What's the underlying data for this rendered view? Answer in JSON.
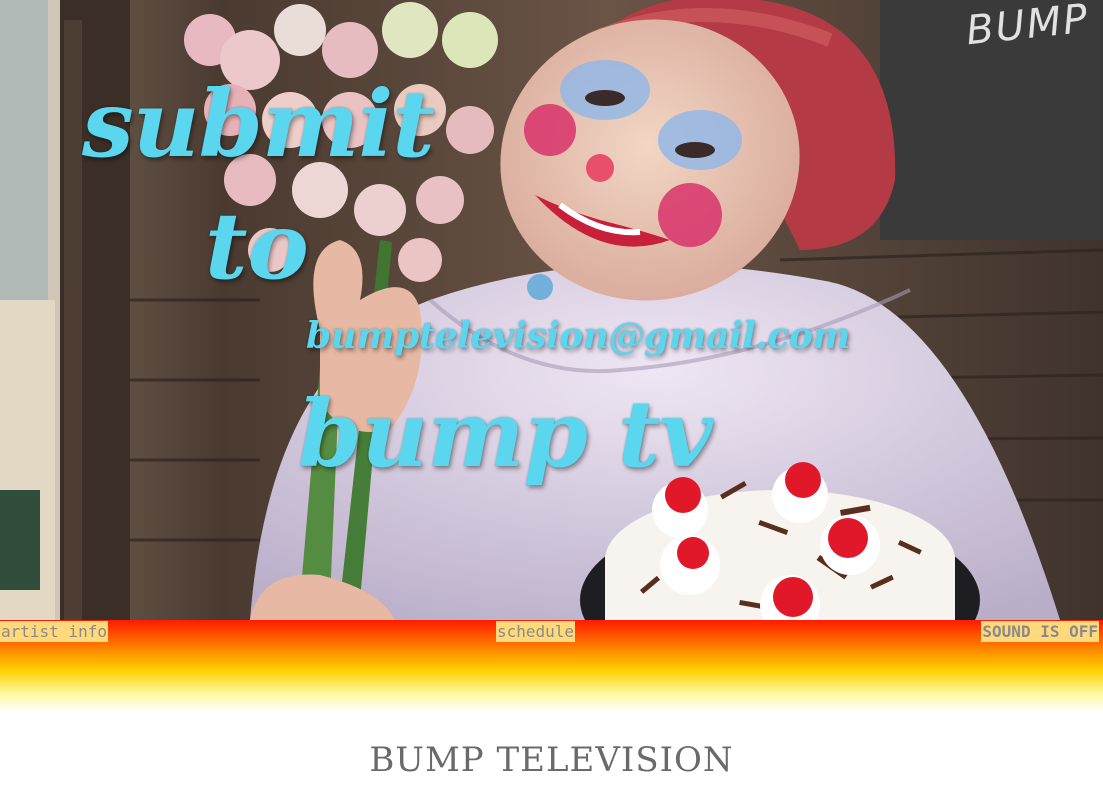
{
  "video": {
    "watermark": "BUMP",
    "overlay": {
      "line1": "submit",
      "line2": "to",
      "email": "bumptelevision@gmail.com",
      "line3": "bump tv"
    }
  },
  "nav": {
    "artist_info_label": "artist info",
    "schedule_label": "schedule",
    "sound_label": "SOUND IS OFF"
  },
  "footer": {
    "title": "BUMP TELEVISION"
  },
  "colors": {
    "overlay_text": "#5ad6ef",
    "nav_button_bg": "#ffd97a",
    "gradient_top": "#ff1a00",
    "gradient_bottom": "#ffffff"
  }
}
